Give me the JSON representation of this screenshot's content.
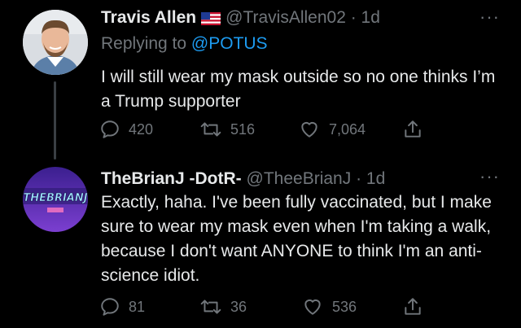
{
  "tweet1": {
    "name": "Travis Allen",
    "handle": "@TravisAllen02",
    "time": "· 1d",
    "replying_prefix": "Replying to ",
    "replying_to": "@POTUS",
    "text": "I will still wear my mask outside so no one thinks I’m a Trump supporter",
    "replies": "420",
    "retweets": "516",
    "likes": "7,064",
    "more": "···"
  },
  "tweet2": {
    "name": "TheBrianJ -DotR-",
    "handle": "@TheeBrianJ",
    "time": "· 1d",
    "avatar_text": "THEBRIANJ",
    "text": "Exactly, haha. I've been fully vaccinated, but I make sure to wear my mask even when I'm taking a walk, because I don't want ANYONE to think I'm an anti-science idiot.",
    "replies": "81",
    "retweets": "36",
    "likes": "536",
    "more": "···"
  },
  "colors": {
    "background": "#000000",
    "muted": "#71767b",
    "link": "#1d9bf0",
    "thread_line": "#3a3f44"
  }
}
